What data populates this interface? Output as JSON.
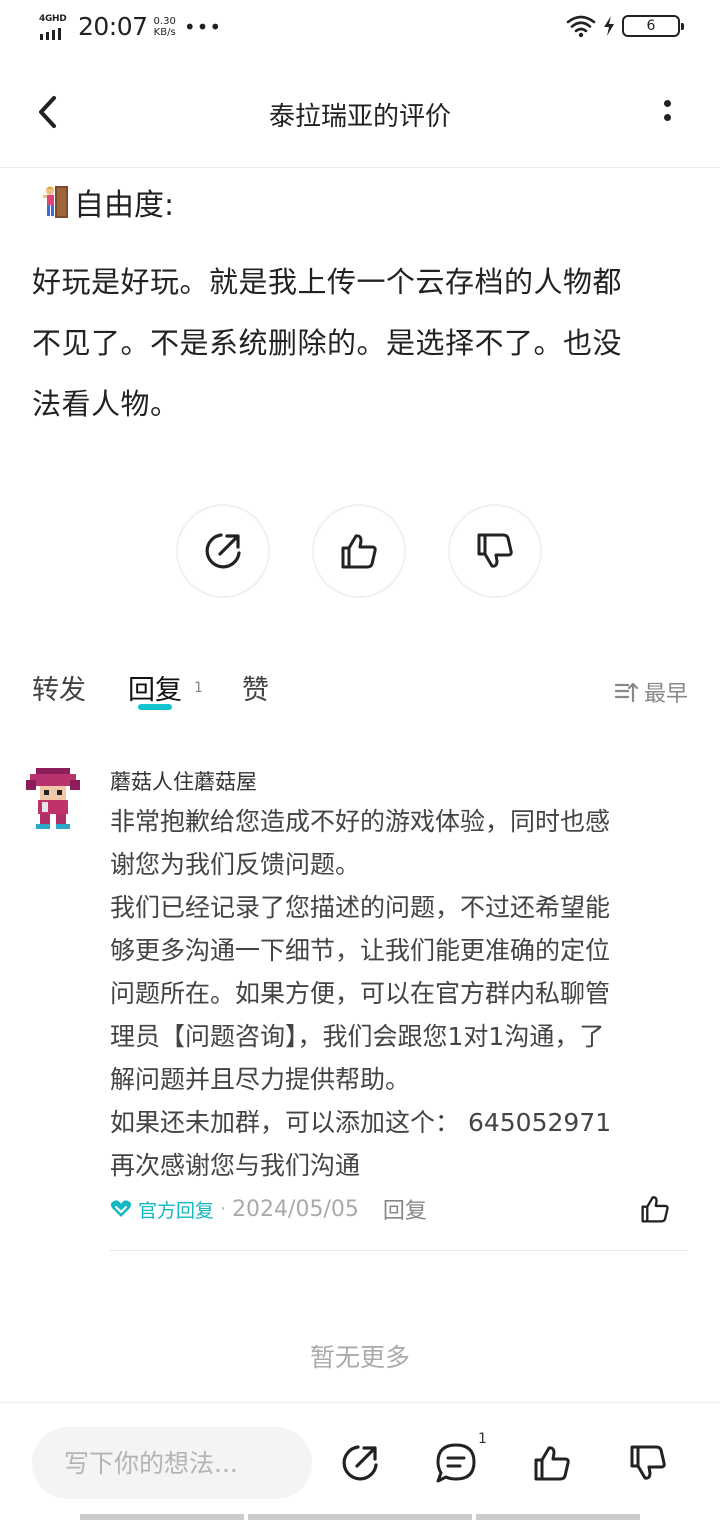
{
  "status_bar": {
    "network": "4GHD",
    "time": "20:07",
    "speed_value": "0.30",
    "speed_unit": "KB/s",
    "dots": "•••",
    "battery": "6"
  },
  "header": {
    "title": "泰拉瑞亚的评价"
  },
  "review": {
    "tag_label": "自由度:",
    "lines": [
      "好玩是好玩。就是我上传一个云存档的人物都",
      "不见了。不是系统删除的。是选择不了。也没",
      "法看人物。"
    ]
  },
  "tabs": {
    "forward": "转发",
    "reply": "回复",
    "reply_count": "1",
    "like": "赞",
    "sort": "最早"
  },
  "reply": {
    "name": "蘑菇人住蘑菇屋",
    "lines": [
      "非常抱歉给您造成不好的游戏体验，同时也感",
      "谢您为我们反馈问题。",
      "我们已经记录了您描述的问题，不过还希望能",
      "够更多沟通一下细节，让我们能更准确的定位",
      "问题所在。如果方便，可以在官方群内私聊管",
      "理员【问题咨询】，我们会跟您1对1沟通，了",
      "解问题并且尽力提供帮助。",
      "如果还未加群，可以添加这个： 645052971",
      "再次感谢您与我们沟通"
    ],
    "official_label": "官方回复",
    "separator": "·",
    "date": "2024/05/05",
    "reply_action": "回复"
  },
  "no_more": "暂无更多",
  "bottom_bar": {
    "input_placeholder": "写下你的想法...",
    "comment_badge": "1"
  },
  "colors": {
    "accent": "#15c5ce",
    "text": "#222222",
    "muted": "#aaaaaa"
  }
}
